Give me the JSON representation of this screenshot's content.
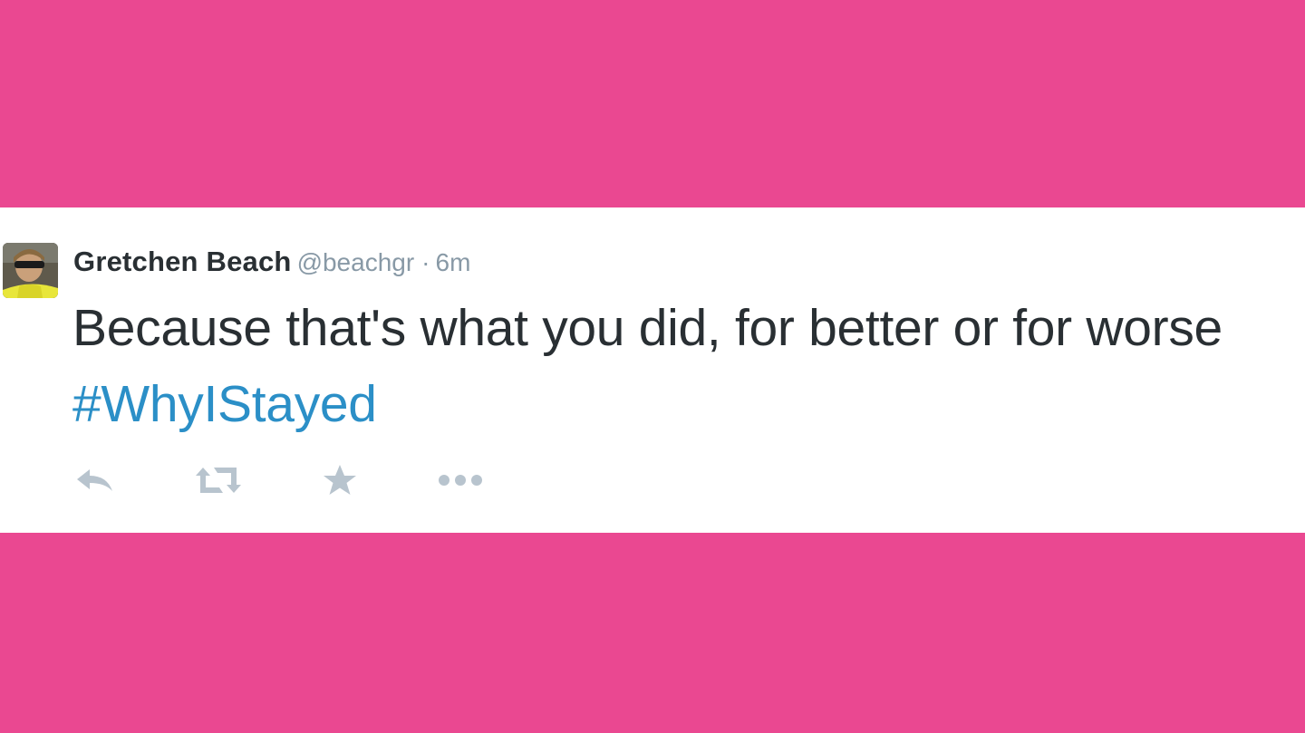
{
  "colors": {
    "background": "#ea4891",
    "card": "#ffffff",
    "text": "#292f33",
    "muted": "#8899a6",
    "hashtag": "#2b8fc7",
    "icon": "#b8c4ce"
  },
  "tweet": {
    "author_name": "Gretchen Beach",
    "author_handle": "@beachgr",
    "separator": "·",
    "time": "6m",
    "text": "Because that's what you did, for better or for worse",
    "hashtag": "#WhyIStayed",
    "avatar_icon": "user-avatar",
    "actions": [
      {
        "name": "reply",
        "icon": "reply-icon"
      },
      {
        "name": "retweet",
        "icon": "retweet-icon"
      },
      {
        "name": "favorite",
        "icon": "star-icon"
      },
      {
        "name": "more",
        "icon": "more-dots-icon"
      }
    ]
  }
}
